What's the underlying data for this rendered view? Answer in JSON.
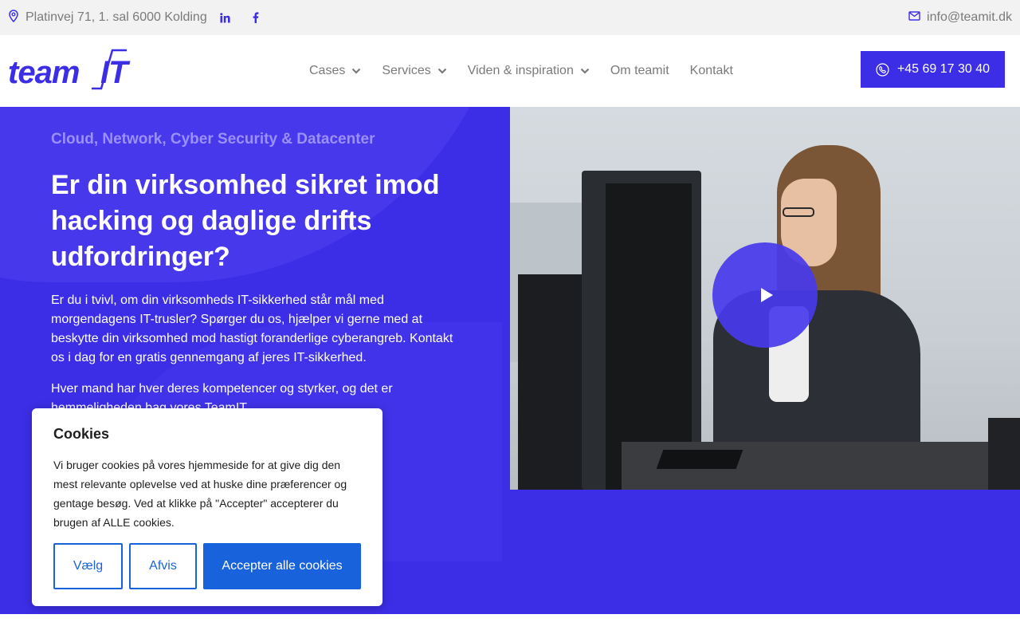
{
  "topbar": {
    "address": "Platinvej 71, 1. sal 6000 Kolding",
    "address_icon": "map-pin-icon",
    "social": [
      "linkedin-icon",
      "facebook-icon"
    ],
    "email": "info@teamit.dk",
    "email_icon": "envelope-icon"
  },
  "header": {
    "logo_text_1": "team",
    "logo_text_2": "IT",
    "nav": [
      {
        "label": "Cases",
        "has_dropdown": true
      },
      {
        "label": "Services",
        "has_dropdown": true
      },
      {
        "label": "Viden & inspiration",
        "has_dropdown": true
      },
      {
        "label": "Om teamit",
        "has_dropdown": false
      },
      {
        "label": "Kontakt",
        "has_dropdown": false
      }
    ],
    "phone": "+45 69 17 30 40",
    "phone_icon": "phone-icon"
  },
  "hero": {
    "eyebrow": "Cloud, Network, Cyber Security & Datacenter",
    "title": "Er din virksomhed sikret imod hacking og daglige drifts udfordringer?",
    "paragraph_1": "Er du i tvivl, om din virksomheds IT-sikkerhed står mål med morgendagens IT-trusler? Spørger du os, hjælper vi gerne med at beskytte din virksomhed mod hastigt foranderlige cyberangreb. Kontakt os i dag for en gratis gennemgang af jeres IT-sikkerhed.",
    "paragraph_2": "Hver mand har hver deres kompetencer og styrker, og det er hemmeligheden bag vores TeamIT.",
    "play_icon": "play-icon"
  },
  "cookie": {
    "title": "Cookies",
    "text": "Vi bruger cookies på vores hjemmeside for at give dig den mest relevante oplevelse ved at huske dine præferencer og gentage besøg. Ved at klikke på \"Accepter\" accepterer du brugen af ALLE cookies.",
    "btn_choose": "Vælg",
    "btn_reject": "Afvis",
    "btn_accept": "Accepter alle cookies"
  },
  "colors": {
    "brand": "#3c2ee6",
    "cookie_accent": "#1863dc",
    "topbar_bg": "#f2f2f2",
    "text_muted": "#7a7a7a"
  }
}
